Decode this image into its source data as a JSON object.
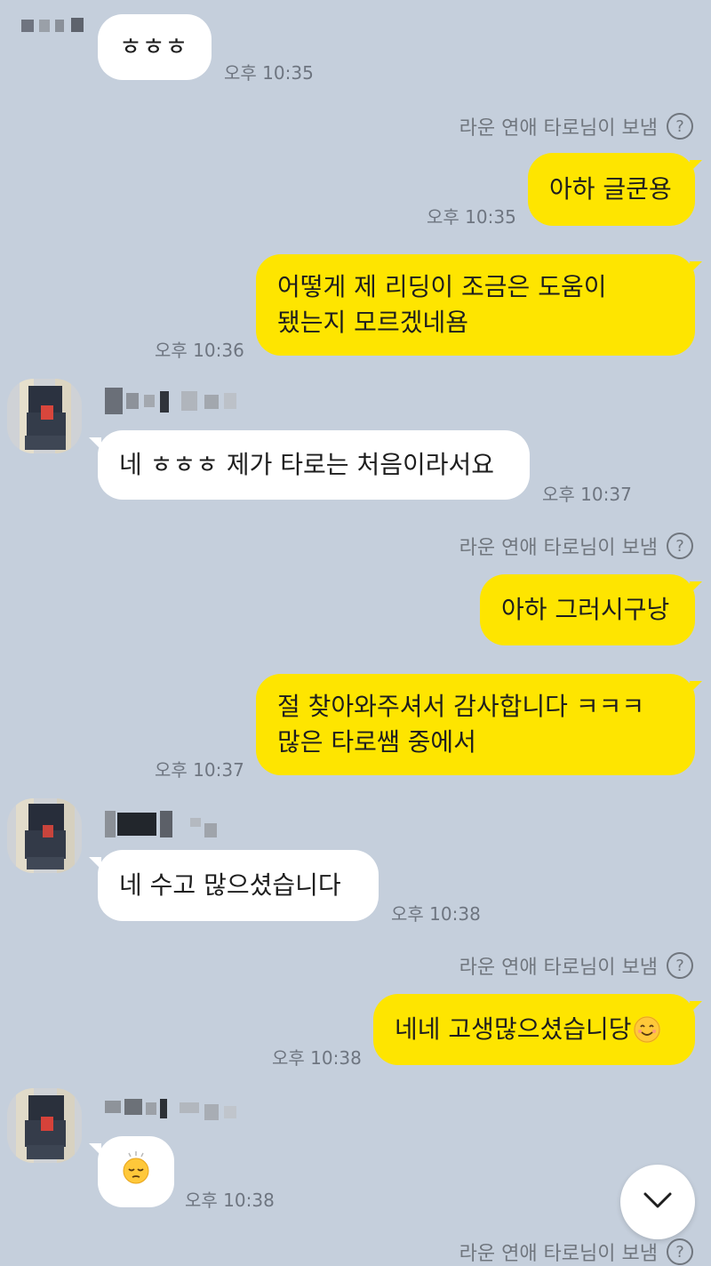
{
  "messages": {
    "m1": {
      "text": "ㅎㅎㅎ",
      "time": "오후 10:35"
    },
    "sender1": {
      "label": "라운 연애 타로님이 보냄",
      "help": "?"
    },
    "m2": {
      "text": "아하 글쿤용",
      "time": "오후 10:35"
    },
    "m3": {
      "text": "어떻게 제 리딩이 조금은 도움이\n됐는지 모르겠네욤",
      "time": "오후 10:36"
    },
    "m4": {
      "text": "네 ㅎㅎㅎ 제가 타로는 처음이라서요",
      "time": "오후 10:37"
    },
    "sender2": {
      "label": "라운 연애 타로님이 보냄",
      "help": "?"
    },
    "m5": {
      "text": "아하 그러시구낭",
      "time": ""
    },
    "m6": {
      "text": "절 찾아와주셔서 감사합니다 ㅋㅋㅋ\n많은 타로쌤 중에서",
      "time": "오후 10:37"
    },
    "m7": {
      "text": "네 수고 많으셨습니다",
      "time": "오후 10:38"
    },
    "sender3": {
      "label": "라운 연애 타로님이 보냄",
      "help": "?"
    },
    "m8": {
      "text": "네네 고생많으셨습니당",
      "time": "오후 10:38"
    },
    "m9": {
      "time": "오후 10:38"
    },
    "sender4": {
      "label": "라운 연애 타로님이 보냄",
      "help": "?"
    }
  },
  "icons": {
    "help": "question-circle-icon",
    "scroll": "chevron-down-icon",
    "emoji_smile": "smiling-face-icon",
    "emoji_sleepy": "sleepy-face-icon"
  },
  "colors": {
    "background": "#c5cfdc",
    "outgoing_bubble": "#fee500",
    "incoming_bubble": "#ffffff"
  }
}
